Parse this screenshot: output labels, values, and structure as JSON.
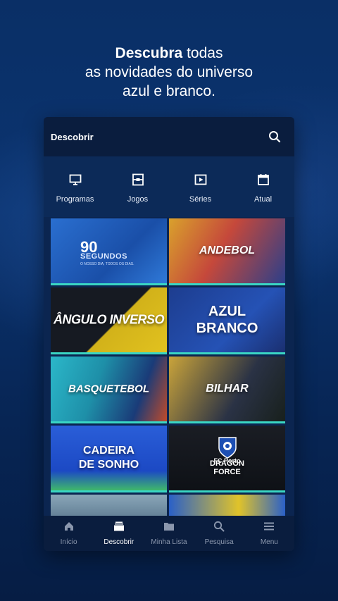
{
  "headline": {
    "bold": "Descubra",
    "line1_rest": " todas",
    "line2": "as novidades do universo",
    "line3": "azul e branco."
  },
  "topbar": {
    "title": "Descobrir",
    "search_icon": "search-icon"
  },
  "categories": [
    {
      "label": "Programas",
      "icon": "monitor-icon"
    },
    {
      "label": "Jogos",
      "icon": "field-icon"
    },
    {
      "label": "Séries",
      "icon": "play-icon"
    },
    {
      "label": "Atual",
      "icon": "calendar-icon"
    }
  ],
  "tiles": [
    {
      "big": "90",
      "sub": "SEGUNDOS",
      "tag": "O NOSSO DIA, TODOS OS DIAS."
    },
    {
      "label": "ANDEBOL"
    },
    {
      "label": "ÂNGULO INVERSO"
    },
    {
      "label1": "AZUL",
      "label2": "BRANCO"
    },
    {
      "label": "BASQUETEBOL"
    },
    {
      "label": "BILHAR"
    },
    {
      "label1": "CADEIRA",
      "label2": "DE SONHO"
    },
    {
      "fc": "FC Porto",
      "df1": "DRAGON",
      "df2": "FORCE"
    }
  ],
  "nav": [
    {
      "label": "Início",
      "icon": "home-icon"
    },
    {
      "label": "Descobrir",
      "icon": "stack-icon",
      "active": true
    },
    {
      "label": "Minha Lista",
      "icon": "folder-icon"
    },
    {
      "label": "Pesquisa",
      "icon": "search-icon"
    },
    {
      "label": "Menu",
      "icon": "menu-icon"
    }
  ],
  "colors": {
    "accent": "#3ad6c4",
    "background": "#0b3470",
    "bar": "#0a1d3e"
  }
}
